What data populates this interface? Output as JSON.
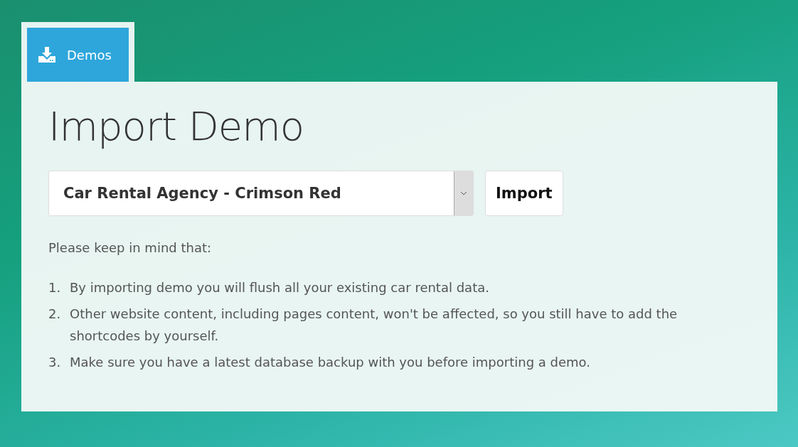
{
  "tabs": [
    {
      "label": "Demos",
      "selected": true
    }
  ],
  "title": "Import Demo",
  "demo_select": {
    "value": "Car Rental Agency - Crimson Red"
  },
  "import_button": {
    "label": "Import"
  },
  "intro": "Please keep in mind that:",
  "notes": [
    {
      "number": "1.",
      "text": "By importing demo you will flush all your existing car rental data."
    },
    {
      "number": "2.",
      "text": "Other website content, including pages content, won't be affected, so you still have to add the shortcodes by yourself."
    },
    {
      "number": "3.",
      "text": "Make sure you have a latest database backup with you before importing a demo."
    }
  ]
}
